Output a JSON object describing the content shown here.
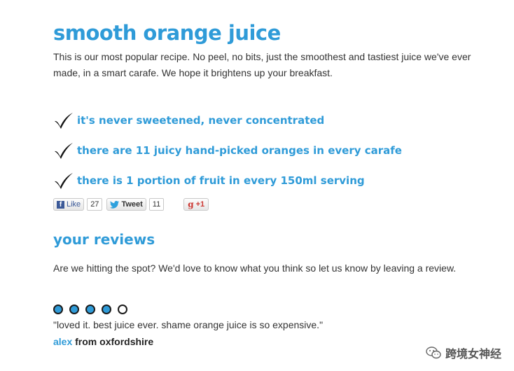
{
  "product": {
    "title": "smooth orange juice",
    "intro": "This is our most popular recipe. No peel, no bits, just the smoothest and tastiest juice we've ever made, in a smart carafe. We hope it brightens up your breakfast."
  },
  "benefits": [
    {
      "text": "it's never sweetened, never concentrated",
      "icon": "checkmark-icon"
    },
    {
      "text": "there are 11 juicy hand-picked oranges in every carafe",
      "icon": "checkmark-icon"
    },
    {
      "text": "there is 1 portion of fruit in every 150ml serving",
      "icon": "checkmark-icon"
    }
  ],
  "social": {
    "facebook_label": "Like",
    "facebook_count": "27",
    "twitter_label": "Tweet",
    "twitter_count": "11",
    "gplus_label": "+1"
  },
  "reviews": {
    "title": "your reviews",
    "intro": "Are we hitting the spot? We'd love to know what you think so let us know by leaving a review.",
    "items": [
      {
        "rating": 4,
        "max_rating": 5,
        "quote": "\"loved it. best juice ever. shame orange juice is so expensive.\"",
        "name": "alex",
        "location": " from oxfordshire"
      }
    ]
  },
  "watermark": {
    "text": "跨境女神经",
    "icon": "wechat-icon"
  },
  "colors": {
    "accent": "#2f9bd8",
    "text": "#333333",
    "gplus": "#cc3732",
    "facebook": "#3b5998"
  }
}
